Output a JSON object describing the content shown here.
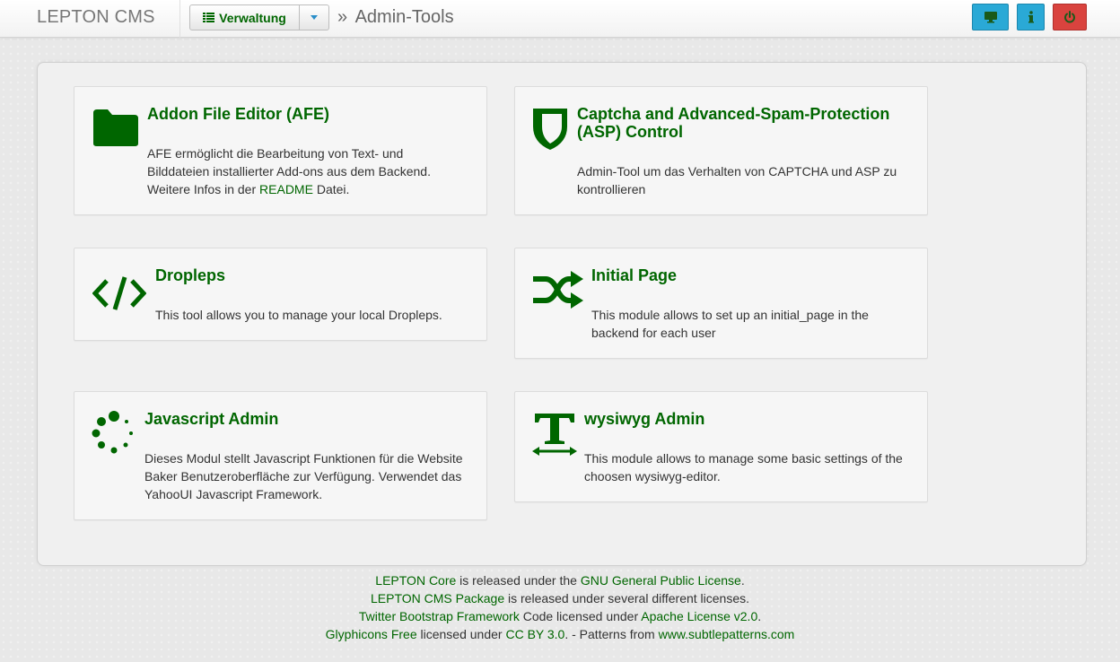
{
  "header": {
    "brand": "LEPTON CMS",
    "menu_label": "Verwaltung",
    "breadcrumb_sep": "»",
    "breadcrumb_current": "Admin-Tools",
    "buttons": [
      {
        "name": "frontend-button",
        "icon": "monitor-icon",
        "color": "#2aa9d6"
      },
      {
        "name": "info-button",
        "icon": "info-icon",
        "color": "#2aa9d6"
      },
      {
        "name": "logout-button",
        "icon": "power-icon",
        "color": "#d9433e"
      }
    ]
  },
  "theme": {
    "accent": "#006600"
  },
  "tools": {
    "afe": {
      "title": "Addon File Editor (AFE)",
      "icon": "folder-icon",
      "desc_line1": "AFE ermöglicht die Bearbeitung von Text- und",
      "desc_line2": "Bilddateien installierter Add-ons aus dem Backend.",
      "desc_line3_pre": "Weitere Infos in der ",
      "desc_line3_link": "README",
      "desc_line3_post": " Datei."
    },
    "captcha": {
      "title_line1": "Captcha and Advanced-Spam-Protection",
      "title_line2": "(ASP) Control",
      "icon": "shield-icon",
      "desc_line1": "Admin-Tool um das Verhalten von CAPTCHA und ASP zu",
      "desc_line2": "kontrollieren"
    },
    "dropleps": {
      "title": "Dropleps",
      "icon": "code-icon",
      "desc_line1": "This tool allows you to manage your local Dropleps."
    },
    "initial_page": {
      "title": "Initial Page",
      "icon": "shuffle-icon",
      "desc_line1": "This module allows to set up an initial_page in the",
      "desc_line2": "backend for each user"
    },
    "javascript_admin": {
      "title": "Javascript Admin",
      "icon": "spinner-icon",
      "desc_line1": "Dieses Modul stellt Javascript Funktionen für die Website",
      "desc_line2": "Baker Benutzeroberfläche zur Verfügung. Verwendet das",
      "desc_line3": "YahooUI Javascript Framework."
    },
    "wysiwyg_admin": {
      "title": "wysiwyg Admin",
      "icon": "text-width-icon",
      "desc_line1": "This module allows to manage some basic settings of the",
      "desc_line2": "choosen wysiwyg-editor."
    }
  },
  "footer": {
    "line1_link1": "LEPTON Core",
    "line1_text": " is released under the ",
    "line1_link2": "GNU General Public License",
    "line1_end": ".",
    "line2_link": "LEPTON CMS Package",
    "line2_text": " is released under several different licenses.",
    "line3_link1": "Twitter Bootstrap Framework",
    "line3_text": " Code licensed under ",
    "line3_link2": "Apache License v2.0",
    "line3_end": ".",
    "line4_link1": "Glyphicons Free",
    "line4_text1": " licensed under ",
    "line4_link2": "CC BY 3.0",
    "line4_text2": ". - Patterns from ",
    "line4_link3": "www.subtlepatterns.com"
  }
}
